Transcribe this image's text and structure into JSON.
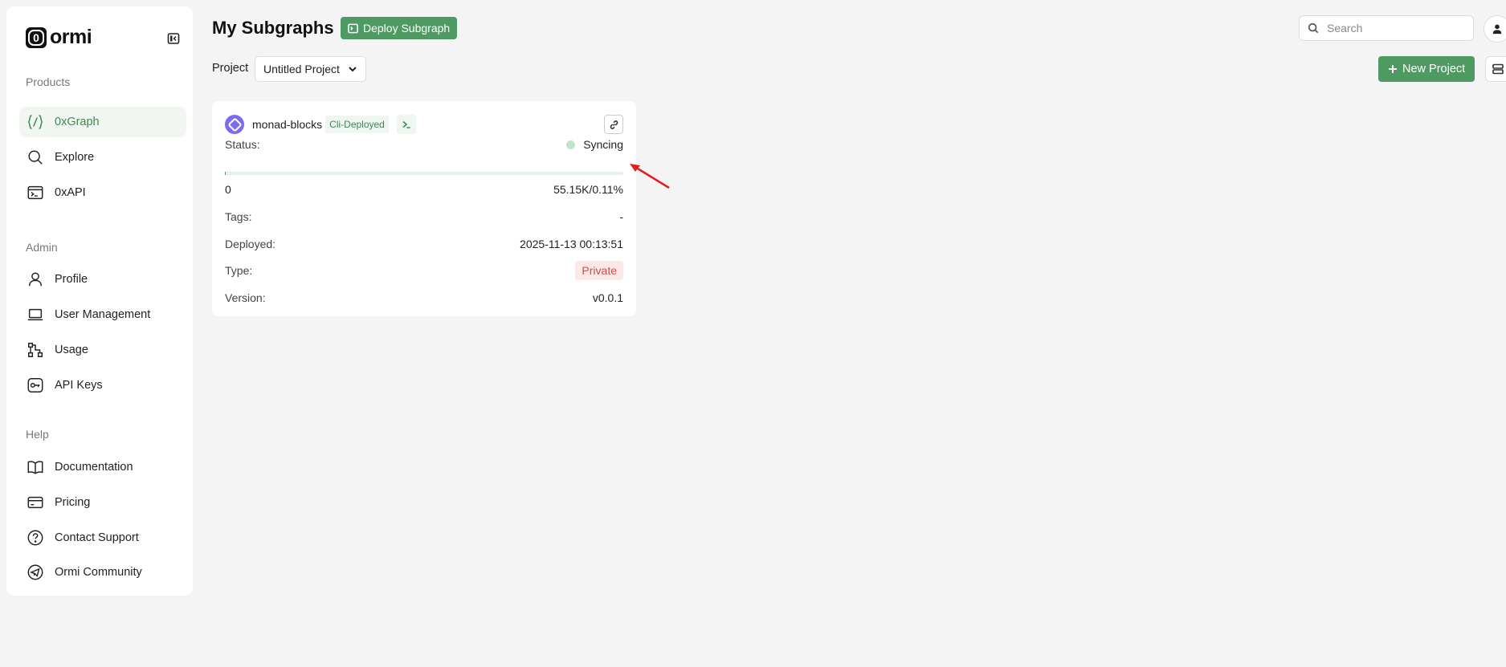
{
  "app": {
    "logo_text": "ormi",
    "logo_mark": "0"
  },
  "sidebar": {
    "sections": [
      {
        "label": "Products"
      },
      {
        "label": "Admin"
      },
      {
        "label": "Help"
      }
    ],
    "items": [
      {
        "label": "0xGraph",
        "icon": "braces-icon",
        "active": true
      },
      {
        "label": "Explore",
        "icon": "search-icon"
      },
      {
        "label": "0xAPI",
        "icon": "terminal-icon"
      },
      {
        "label": "Profile",
        "icon": "user-icon"
      },
      {
        "label": "User Management",
        "icon": "laptop-icon"
      },
      {
        "label": "Usage",
        "icon": "usage-icon"
      },
      {
        "label": "API Keys",
        "icon": "key-icon"
      },
      {
        "label": "Documentation",
        "icon": "book-icon"
      },
      {
        "label": "Pricing",
        "icon": "card-icon"
      },
      {
        "label": "Contact Support",
        "icon": "help-icon"
      },
      {
        "label": "Ormi Community",
        "icon": "telegram-icon"
      }
    ]
  },
  "header": {
    "title": "My Subgraphs",
    "deploy_label": "Deploy Subgraph",
    "search_placeholder": "Search",
    "project_label": "Project",
    "project_selected": "Untitled Project",
    "new_project_label": "New Project"
  },
  "card": {
    "name": "monad-blocks",
    "badge": "Cli-Deployed",
    "status_label": "Status:",
    "status_value": "Syncing",
    "progress_start": "0",
    "progress_text": "55.15K/0.11%",
    "progress_fraction": 0.0011,
    "tags_label": "Tags:",
    "tags_value": "-",
    "deployed_label": "Deployed:",
    "deployed_value": "2025-11-13 00:13:51",
    "type_label": "Type:",
    "type_value": "Private",
    "version_label": "Version:",
    "version_value": "v0.0.1"
  },
  "colors": {
    "accent": "#4e9a62",
    "private": "#d44a4a",
    "annotation_arrow": "#e02020"
  }
}
